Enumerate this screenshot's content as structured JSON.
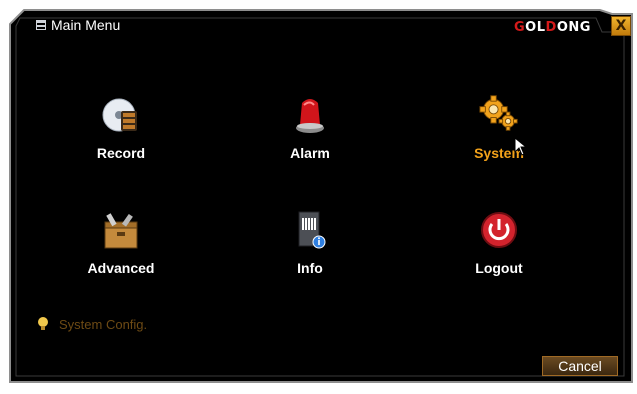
{
  "window": {
    "title": "Main Menu",
    "brand_part1": "",
    "brand_accent1": "G",
    "brand_mid": "OL",
    "brand_accent2": "D",
    "brand_end": "ONG",
    "close_label": "X"
  },
  "menu": {
    "record": {
      "label": "Record",
      "icon": "record-disc-film-icon"
    },
    "alarm": {
      "label": "Alarm",
      "icon": "alarm-siren-icon"
    },
    "system": {
      "label": "System",
      "icon": "gears-icon"
    },
    "advanced": {
      "label": "Advanced",
      "icon": "toolbox-icon"
    },
    "info": {
      "label": "Info",
      "icon": "info-server-icon"
    },
    "logout": {
      "label": "Logout",
      "icon": "power-icon"
    }
  },
  "hint": {
    "text": "System Config.",
    "icon": "lightbulb-icon"
  },
  "footer": {
    "cancel_label": "Cancel"
  },
  "colors": {
    "background": "#000000",
    "frame": "#9a9a9a",
    "accent": "#f3a21a",
    "hint_text": "#6d4a14"
  }
}
